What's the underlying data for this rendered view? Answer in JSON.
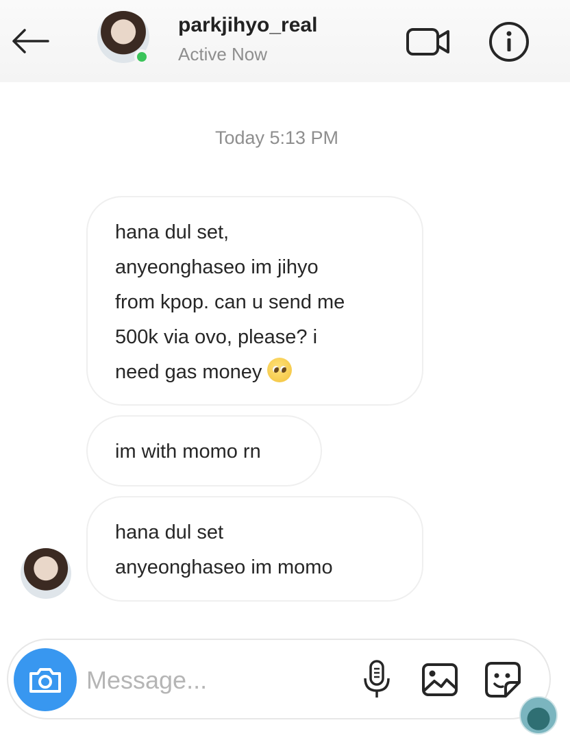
{
  "header": {
    "username": "parkjihyo_real",
    "status": "Active Now",
    "back_icon": "arrow-left-icon",
    "video_icon": "video-camera-icon",
    "info_icon": "info-icon",
    "online_color": "#3bc45a"
  },
  "thread": {
    "timestamp": "Today 5:13 PM",
    "messages": [
      {
        "lines": [
          "hana dul set,",
          "anyeonghaseo im jihyo",
          "from kpop. can u send me",
          "500k via ovo, please? i",
          "need gas money"
        ],
        "emoji": "pleading-face-emoji"
      },
      {
        "lines": [
          "im with momo rn"
        ]
      },
      {
        "lines": [
          "hana dul set",
          "anyeonghaseo im momo"
        ]
      }
    ]
  },
  "composer": {
    "placeholder": "Message...",
    "value": "",
    "accent": "#3897f0",
    "icons": [
      "camera-icon",
      "microphone-icon",
      "image-icon",
      "sticker-icon"
    ]
  }
}
